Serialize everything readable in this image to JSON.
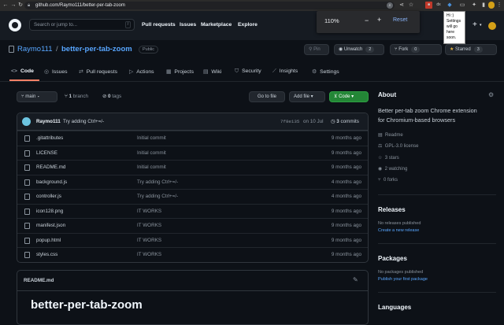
{
  "browser": {
    "url": "github.com/Raymo111/better-per-tab-zoom"
  },
  "zoom_popup": {
    "level": "110%",
    "minus": "−",
    "plus": "+",
    "reset": "Reset"
  },
  "ext_popup": {
    "text": "Hi :) Settings will go here soon."
  },
  "header": {
    "search_placeholder": "Search or jump to...",
    "slash": "/",
    "nav": [
      "Pull requests",
      "Issues",
      "Marketplace",
      "Explore"
    ]
  },
  "repo": {
    "owner": "Raymo111",
    "sep": "/",
    "name": "better-per-tab-zoom",
    "visibility": "Public",
    "pin": "Pin",
    "watch": "Unwatch",
    "watch_count": "2",
    "fork": "Fork",
    "fork_count": "0",
    "star": "Starred",
    "star_count": "3"
  },
  "tabs": [
    {
      "icon": "<>",
      "label": "Code"
    },
    {
      "icon": "◎",
      "label": "Issues"
    },
    {
      "icon": "⇄",
      "label": "Pull requests"
    },
    {
      "icon": "▷",
      "label": "Actions"
    },
    {
      "icon": "▦",
      "label": "Projects"
    },
    {
      "icon": "▤",
      "label": "Wiki"
    },
    {
      "icon": "⛉",
      "label": "Security"
    },
    {
      "icon": "⟋",
      "label": "Insights"
    },
    {
      "icon": "⚙",
      "label": "Settings"
    }
  ],
  "toolbar": {
    "branch": "main",
    "branches": "1",
    "branches_label": "branch",
    "tags": "0",
    "tags_label": "tags",
    "goto": "Go to file",
    "addfile": "Add file",
    "code": "Code"
  },
  "commit": {
    "author": "Raymo111",
    "message": "Try adding Ctrl+=/-",
    "hash": "7f8e135",
    "date": "on 10 Jul",
    "count": "3",
    "count_label": "commits"
  },
  "files": [
    {
      "name": ".gitattributes",
      "msg": "Initial commit",
      "time": "9 months ago"
    },
    {
      "name": "LICENSE",
      "msg": "Initial commit",
      "time": "9 months ago"
    },
    {
      "name": "README.md",
      "msg": "Initial commit",
      "time": "9 months ago"
    },
    {
      "name": "background.js",
      "msg": "Try adding Ctrl+=/-",
      "time": "4 months ago"
    },
    {
      "name": "controller.js",
      "msg": "Try adding Ctrl+=/-",
      "time": "4 months ago"
    },
    {
      "name": "icon128.png",
      "msg": "IT WORKS",
      "time": "9 months ago"
    },
    {
      "name": "manifest.json",
      "msg": "IT WORKS",
      "time": "9 months ago"
    },
    {
      "name": "popup.html",
      "msg": "IT WORKS",
      "time": "9 months ago"
    },
    {
      "name": "styles.css",
      "msg": "IT WORKS",
      "time": "9 months ago"
    }
  ],
  "readme": {
    "filename": "README.md",
    "title": "better-per-tab-zoom"
  },
  "about": {
    "heading": "About",
    "desc1": "Better per-tab zoom Chrome extension",
    "desc2": "for Chromium-based browsers",
    "items": [
      {
        "icon": "▤",
        "label": "Readme"
      },
      {
        "icon": "⚖",
        "label": "GPL-3.0 license"
      },
      {
        "icon": "☆",
        "label": "3 stars"
      },
      {
        "icon": "◉",
        "label": "2 watching"
      },
      {
        "icon": "⑂",
        "label": "0 forks"
      }
    ]
  },
  "releases": {
    "heading": "Releases",
    "text": "No releases published",
    "link": "Create a new release"
  },
  "packages": {
    "heading": "Packages",
    "text": "No packages published",
    "link": "Publish your first package"
  },
  "languages": {
    "heading": "Languages"
  }
}
